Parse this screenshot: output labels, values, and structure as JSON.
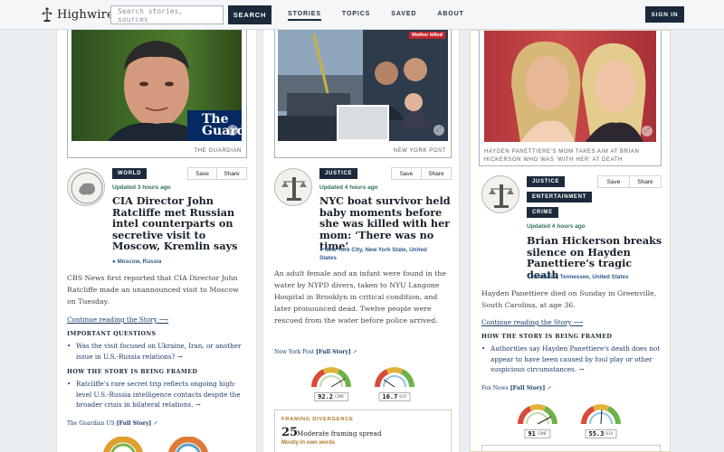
{
  "header": {
    "logo_text": "Highwire",
    "search_placeholder": "Search stories, sources",
    "search_button": "SEARCH",
    "nav": [
      "STORIES",
      "TOPICS",
      "SAVED",
      "ABOUT"
    ],
    "signin": "SIGN IN"
  },
  "cards": [
    {
      "caption": "THE GUARDIAN",
      "logo_overlay": "The Guardian",
      "category_tags": [
        "WORLD"
      ],
      "save": "Save",
      "share": "Share",
      "updated": "Updated 3 hours ago",
      "headline": "CIA Director John Ratcliffe met Russian intel counterparts on secretive visit to Moscow, Kremlin says",
      "location": "Moscow, Russia",
      "summary": "CBS News first reported that CIA Director John Ratcliffe made an unannounced visit to Moscow on Tuesday.",
      "continue": "Continue reading the Story ⟶",
      "questions_title": "IMPORTANT QUESTIONS",
      "questions": [
        "Was the visit focused on Ukraine, Iran, or another issue in U.S.-Russia relations? →"
      ],
      "framing_title": "HOW THE STORY IS BEING FRAMED",
      "framing": [
        "Ratcliffe's rare secret trip reflects ongoing high-level U.S.-Russia intelligence contacts despite the broader crisis in bilateral relations. →"
      ],
      "source_name": "The Guardian US",
      "source_link": "[Full Story]"
    },
    {
      "caption": "NEW YORK POST",
      "badge": "Mother killed",
      "category_tags": [
        "JUSTICE"
      ],
      "save": "Save",
      "share": "Share",
      "updated": "Updated 4 hours ago",
      "headline": "NYC boat survivor held baby moments before she was killed with her mom: ‘There was no time’",
      "location": "New York City, New York State, United States",
      "summary": "An adult female and an infant were found in the water by NYPD divers, taken to NYU Langone Hospital in Brooklyn in critical condition, and later pronounced dead. Twelve people were rescued from the water before police arrived.",
      "source_name": "New York Post",
      "source_link": "[Full Story]",
      "gauges": [
        {
          "value": "92.2",
          "unit": "CONF",
          "level": 0.92
        },
        {
          "value": "16.7",
          "unit": "DIV",
          "level": 0.17
        }
      ],
      "framebox_title": "FRAMING DIVERGENCE",
      "framebox_num": "25",
      "framebox_text": "Moderate framing spread",
      "framebox_sub": "Mostly in own words"
    },
    {
      "caption": "HAYDEN PANETTIERE'S MOM TAKES AIM AT BRIAN HICKERSON WHO WAS 'WITH HER' AT DEATH",
      "category_tags": [
        "JUSTICE",
        "ENTERTAINMENT",
        "CRIME"
      ],
      "save": "Save",
      "share": "Share",
      "updated": "Updated 4 hours ago",
      "headline": "Brian Hickerson breaks silence on Hayden Panettiere's tragic death",
      "location": "Nashville, Tennessee, United States",
      "summary": "Hayden Panettiere died on Sunday in Greenville, South Carolina, at age 36.",
      "continue": "Continue reading the Story ⟶",
      "framing_title": "HOW THE STORY IS BEING FRAMED",
      "framing": [
        "Authorities say Hayden Panettiere's death does not appear to have been caused by foul play or other suspicious circumstances. →"
      ],
      "source_name": "Fox News",
      "source_link": "[Full Story]",
      "gauges": [
        {
          "value": "91",
          "unit": "CONF",
          "level": 0.91
        },
        {
          "value": "55.3",
          "unit": "DIV",
          "level": 0.55
        }
      ]
    }
  ],
  "colors": {
    "navy": "#1b2a3a",
    "accent_gold": "#b0762a",
    "link": "#1b3d66",
    "updated": "#2e6f5a"
  }
}
